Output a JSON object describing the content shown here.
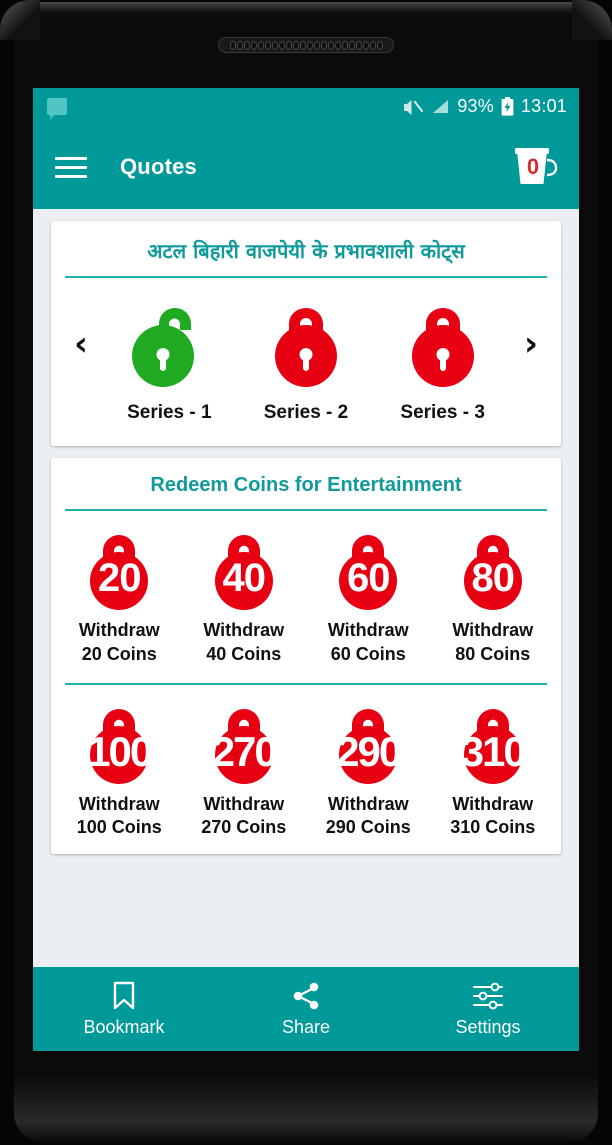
{
  "status_bar": {
    "notification_icon": "chat-bubble-icon",
    "mute_icon": "volume-mute-icon",
    "signal_icon": "signal-bars-icon",
    "battery_percent": "93%",
    "battery_icon": "battery-charging-icon",
    "time": "13:01"
  },
  "app_bar": {
    "menu_icon": "hamburger-menu-icon",
    "title": "Quotes",
    "coin_icon": "coin-bucket-icon",
    "coin_count": "0"
  },
  "quotes_card": {
    "title": "अटल बिहारी वाजपेयी के प्रभावशाली कोट्स",
    "prev_arrow": "‹",
    "next_arrow": "›",
    "series": [
      {
        "label": "Series - 1",
        "state": "unlocked",
        "color": "#1faa21"
      },
      {
        "label": "Series - 2",
        "state": "locked",
        "color": "#e60012"
      },
      {
        "label": "Series - 3",
        "state": "locked",
        "color": "#e60012"
      }
    ]
  },
  "redeem_card": {
    "title": "Redeem Coins for Entertainment",
    "rows": [
      [
        {
          "amount": "20",
          "label_line1": "Withdraw",
          "label_line2": "20 Coins"
        },
        {
          "amount": "40",
          "label_line1": "Withdraw",
          "label_line2": "40 Coins"
        },
        {
          "amount": "60",
          "label_line1": "Withdraw",
          "label_line2": "60 Coins"
        },
        {
          "amount": "80",
          "label_line1": "Withdraw",
          "label_line2": "80 Coins"
        }
      ],
      [
        {
          "amount": "100",
          "label_line1": "Withdraw",
          "label_line2": "100 Coins"
        },
        {
          "amount": "270",
          "label_line1": "Withdraw",
          "label_line2": "270 Coins"
        },
        {
          "amount": "290",
          "label_line1": "Withdraw",
          "label_line2": "290 Coins"
        },
        {
          "amount": "310",
          "label_line1": "Withdraw",
          "label_line2": "310 Coins"
        }
      ]
    ]
  },
  "bottom_nav": [
    {
      "label": "Bookmark",
      "icon": "bookmark-icon"
    },
    {
      "label": "Share",
      "icon": "share-icon"
    },
    {
      "label": "Settings",
      "icon": "sliders-settings-icon"
    }
  ],
  "colors": {
    "teal": "#009999",
    "teal_text": "#119a9a",
    "rule": "#20b2aa",
    "lock_red": "#e60012",
    "lock_green": "#1faa21",
    "coin_red": "#d32f2f"
  }
}
